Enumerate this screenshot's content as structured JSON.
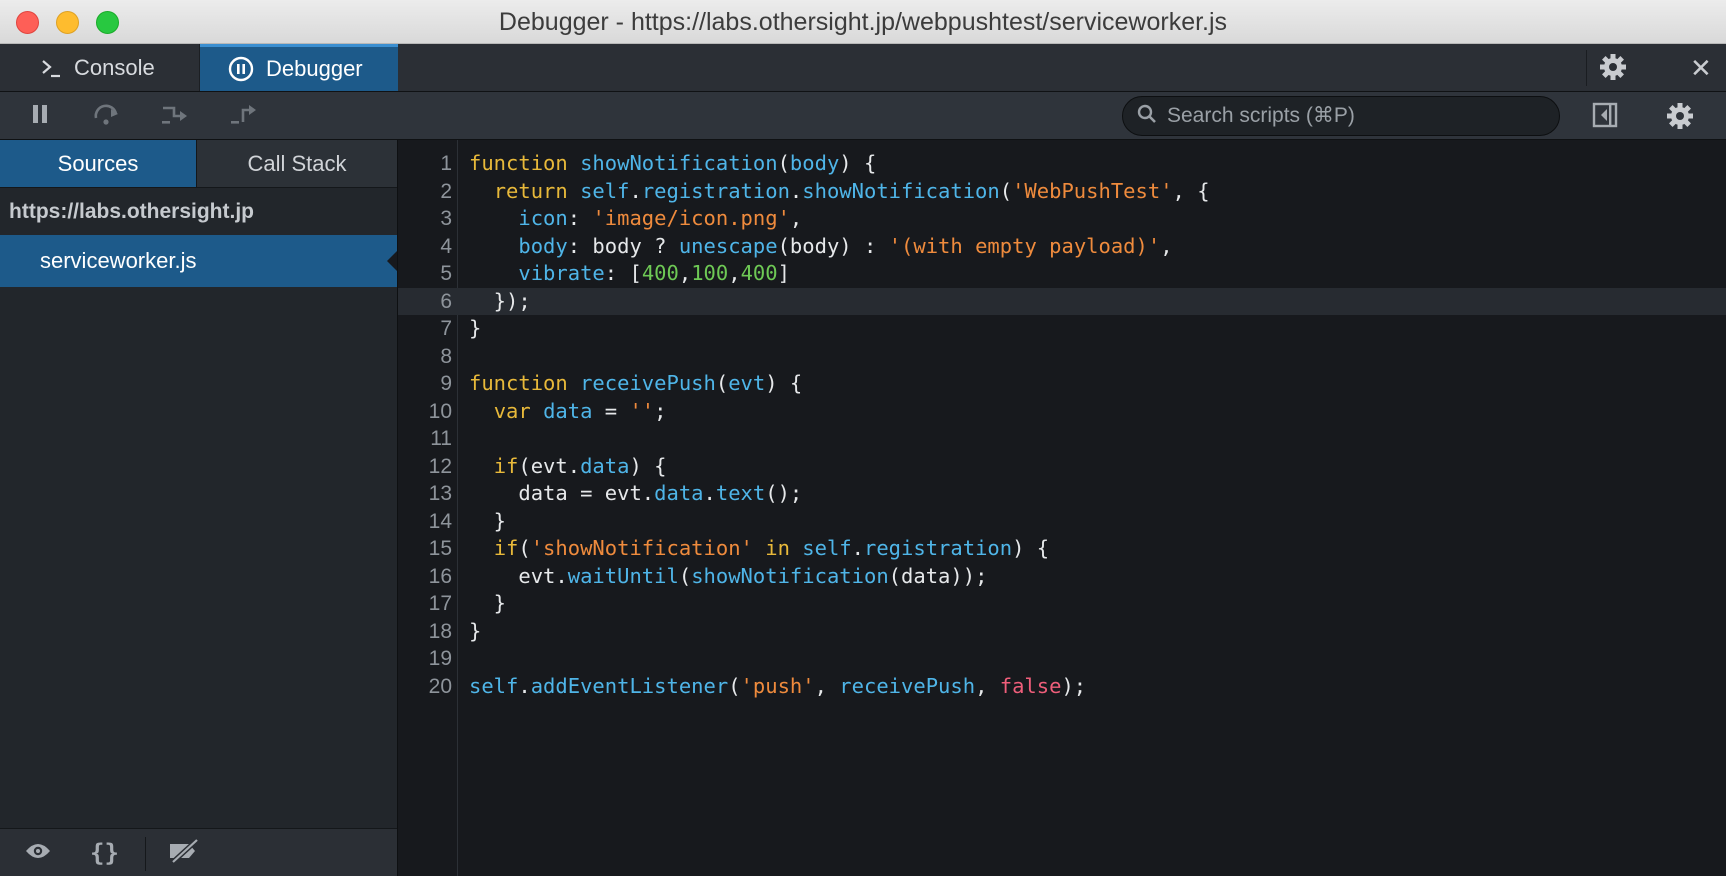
{
  "window": {
    "title": "Debugger - https://labs.othersight.jp/webpushtest/serviceworker.js"
  },
  "tabs": {
    "console_label": "Console",
    "debugger_label": "Debugger"
  },
  "toolbar": {
    "search_placeholder": "Search scripts (⌘P)"
  },
  "sidebar": {
    "tab_sources": "Sources",
    "tab_callstack": "Call Stack",
    "host": "https://labs.othersight.jp",
    "file": "serviceworker.js",
    "bottom_braces": "{}"
  },
  "editor": {
    "current_line": 6,
    "lines": [
      {
        "n": "1",
        "tokens": [
          [
            "kw",
            "function"
          ],
          [
            "pl",
            " "
          ],
          [
            "fn",
            "showNotification"
          ],
          [
            "pl",
            "("
          ],
          [
            "fn",
            "body"
          ],
          [
            "pl",
            ") {"
          ]
        ]
      },
      {
        "n": "2",
        "tokens": [
          [
            "pl",
            "  "
          ],
          [
            "kw",
            "return"
          ],
          [
            "pl",
            " "
          ],
          [
            "fn",
            "self"
          ],
          [
            "pl",
            "."
          ],
          [
            "fn",
            "registration"
          ],
          [
            "pl",
            "."
          ],
          [
            "fn",
            "showNotification"
          ],
          [
            "pl",
            "("
          ],
          [
            "str",
            "'WebPushTest'"
          ],
          [
            "pl",
            ", {"
          ]
        ]
      },
      {
        "n": "3",
        "tokens": [
          [
            "pl",
            "    "
          ],
          [
            "fn",
            "icon"
          ],
          [
            "pl",
            ": "
          ],
          [
            "str",
            "'image/icon.png'"
          ],
          [
            "pl",
            ","
          ]
        ]
      },
      {
        "n": "4",
        "tokens": [
          [
            "pl",
            "    "
          ],
          [
            "fn",
            "body"
          ],
          [
            "pl",
            ": body ? "
          ],
          [
            "fn",
            "unescape"
          ],
          [
            "pl",
            "(body) : "
          ],
          [
            "str",
            "'(with empty payload)'"
          ],
          [
            "pl",
            ","
          ]
        ]
      },
      {
        "n": "5",
        "tokens": [
          [
            "pl",
            "    "
          ],
          [
            "fn",
            "vibrate"
          ],
          [
            "pl",
            ": ["
          ],
          [
            "num",
            "400"
          ],
          [
            "pl",
            ","
          ],
          [
            "num",
            "100"
          ],
          [
            "pl",
            ","
          ],
          [
            "num",
            "400"
          ],
          [
            "pl",
            "]"
          ]
        ]
      },
      {
        "n": "6",
        "tokens": [
          [
            "pl",
            "  });"
          ]
        ]
      },
      {
        "n": "7",
        "tokens": [
          [
            "pl",
            "}"
          ]
        ]
      },
      {
        "n": "8",
        "tokens": []
      },
      {
        "n": "9",
        "tokens": [
          [
            "kw",
            "function"
          ],
          [
            "pl",
            " "
          ],
          [
            "fn",
            "receivePush"
          ],
          [
            "pl",
            "("
          ],
          [
            "fn",
            "evt"
          ],
          [
            "pl",
            ") {"
          ]
        ]
      },
      {
        "n": "10",
        "tokens": [
          [
            "pl",
            "  "
          ],
          [
            "kw",
            "var"
          ],
          [
            "pl",
            " "
          ],
          [
            "fn",
            "data"
          ],
          [
            "pl",
            " = "
          ],
          [
            "str",
            "''"
          ],
          [
            "pl",
            ";"
          ]
        ]
      },
      {
        "n": "11",
        "tokens": []
      },
      {
        "n": "12",
        "tokens": [
          [
            "pl",
            "  "
          ],
          [
            "kw",
            "if"
          ],
          [
            "pl",
            "(evt."
          ],
          [
            "fn",
            "data"
          ],
          [
            "pl",
            ") {"
          ]
        ]
      },
      {
        "n": "13",
        "tokens": [
          [
            "pl",
            "    data = evt."
          ],
          [
            "fn",
            "data"
          ],
          [
            "pl",
            "."
          ],
          [
            "fn",
            "text"
          ],
          [
            "pl",
            "();"
          ]
        ]
      },
      {
        "n": "14",
        "tokens": [
          [
            "pl",
            "  }"
          ]
        ]
      },
      {
        "n": "15",
        "tokens": [
          [
            "pl",
            "  "
          ],
          [
            "kw",
            "if"
          ],
          [
            "pl",
            "("
          ],
          [
            "str",
            "'showNotification'"
          ],
          [
            "pl",
            " "
          ],
          [
            "kw",
            "in"
          ],
          [
            "pl",
            " "
          ],
          [
            "fn",
            "self"
          ],
          [
            "pl",
            "."
          ],
          [
            "fn",
            "registration"
          ],
          [
            "pl",
            ") {"
          ]
        ]
      },
      {
        "n": "16",
        "tokens": [
          [
            "pl",
            "    evt."
          ],
          [
            "fn",
            "waitUntil"
          ],
          [
            "pl",
            "("
          ],
          [
            "fn",
            "showNotification"
          ],
          [
            "pl",
            "(data));"
          ]
        ]
      },
      {
        "n": "17",
        "tokens": [
          [
            "pl",
            "  }"
          ]
        ]
      },
      {
        "n": "18",
        "tokens": [
          [
            "pl",
            "}"
          ]
        ]
      },
      {
        "n": "19",
        "tokens": []
      },
      {
        "n": "20",
        "tokens": [
          [
            "fn",
            "self"
          ],
          [
            "pl",
            "."
          ],
          [
            "fn",
            "addEventListener"
          ],
          [
            "pl",
            "("
          ],
          [
            "str",
            "'push'"
          ],
          [
            "pl",
            ", "
          ],
          [
            "fn",
            "receivePush"
          ],
          [
            "pl",
            ", "
          ],
          [
            "bool",
            "false"
          ],
          [
            "pl",
            ");"
          ]
        ]
      }
    ]
  },
  "colors": {
    "accent_blue": "#1d5a8a",
    "keyword": "#e8b93a",
    "identifier": "#4fb5e8",
    "string": "#ef8b3d",
    "number": "#6ec955",
    "boolean": "#ef5e7a"
  },
  "icons": [
    "console-prompt-icon",
    "pause-circle-icon",
    "gear-icon",
    "close-icon",
    "pause-icon",
    "step-over-icon",
    "step-into-icon",
    "step-out-icon",
    "search-icon",
    "toggle-panel-icon",
    "eye-icon",
    "braces-icon",
    "breakpoints-disabled-icon"
  ]
}
